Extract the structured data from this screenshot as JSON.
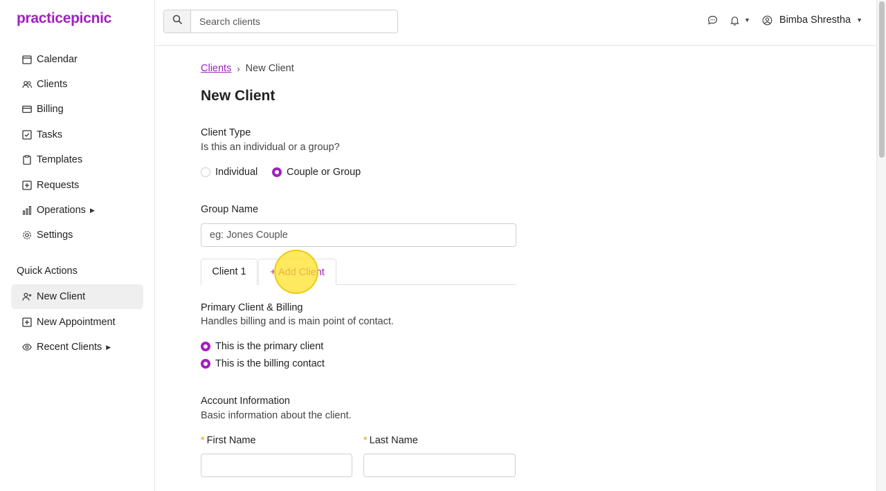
{
  "app": {
    "logo": "practicepicnic"
  },
  "sidebar": {
    "items": [
      {
        "label": "Calendar",
        "icon": "calendar-icon"
      },
      {
        "label": "Clients",
        "icon": "users-icon"
      },
      {
        "label": "Billing",
        "icon": "credit-card-icon"
      },
      {
        "label": "Tasks",
        "icon": "checkbox-icon"
      },
      {
        "label": "Templates",
        "icon": "clipboard-icon"
      },
      {
        "label": "Requests",
        "icon": "plus-square-icon"
      },
      {
        "label": "Operations",
        "icon": "bar-chart-icon",
        "has_submenu": true
      },
      {
        "label": "Settings",
        "icon": "gear-icon"
      }
    ],
    "quick_actions_title": "Quick Actions",
    "quick_actions": [
      {
        "label": "New Client",
        "icon": "user-plus-icon",
        "active": true
      },
      {
        "label": "New Appointment",
        "icon": "plus-square-icon"
      },
      {
        "label": "Recent Clients",
        "icon": "eye-icon",
        "has_submenu": true
      }
    ]
  },
  "header": {
    "search_placeholder": "Search clients",
    "user_name": "Bimba Shrestha"
  },
  "breadcrumb": {
    "parent": "Clients",
    "current": "New Client"
  },
  "page_title": "New Client",
  "client_type": {
    "label": "Client Type",
    "help": "Is this an individual or a group?",
    "options": [
      {
        "label": "Individual",
        "checked": false
      },
      {
        "label": "Couple or Group",
        "checked": true
      }
    ]
  },
  "group_name": {
    "label": "Group Name",
    "placeholder": "eg: Jones Couple"
  },
  "tabs": {
    "client1": "Client 1",
    "add_client": "+ Add Client"
  },
  "primary": {
    "label": "Primary Client & Billing",
    "help": "Handles billing and is main point of contact.",
    "options": [
      {
        "label": "This is the primary client",
        "checked": true
      },
      {
        "label": "This is the billing contact",
        "checked": true
      }
    ]
  },
  "account": {
    "label": "Account Information",
    "help": "Basic information about the client.",
    "first_name_label": "First Name",
    "last_name_label": "Last Name",
    "required_marker": "*"
  },
  "colors": {
    "accent": "#a020c0",
    "required": "#e6a000",
    "highlight": "#ffe128"
  }
}
